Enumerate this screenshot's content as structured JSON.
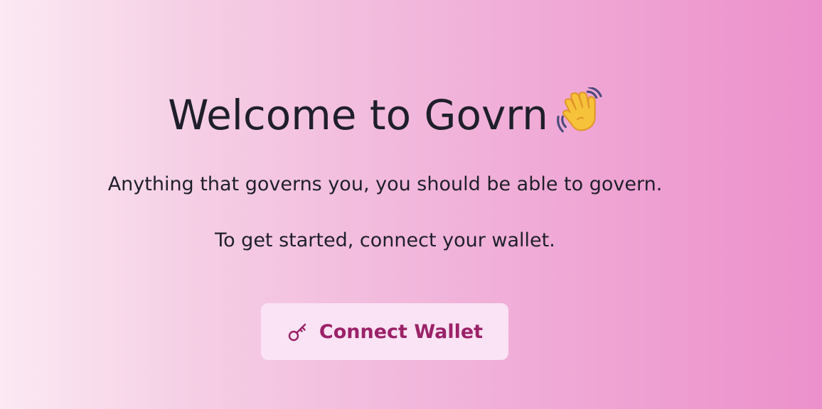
{
  "welcome": {
    "title": "Welcome to Govrn",
    "icon": "waving-hand-icon",
    "subtitle": "Anything that governs you, you should be able to govern.",
    "instruction": "To get started, connect your wallet."
  },
  "connect_button": {
    "label": "Connect Wallet",
    "icon": "key-icon"
  },
  "colors": {
    "background_start": "#fbe9f3",
    "background_end": "#ec90cb",
    "button_background": "#f9e3f4",
    "accent": "#9b2168",
    "text": "#1f1f2b"
  }
}
